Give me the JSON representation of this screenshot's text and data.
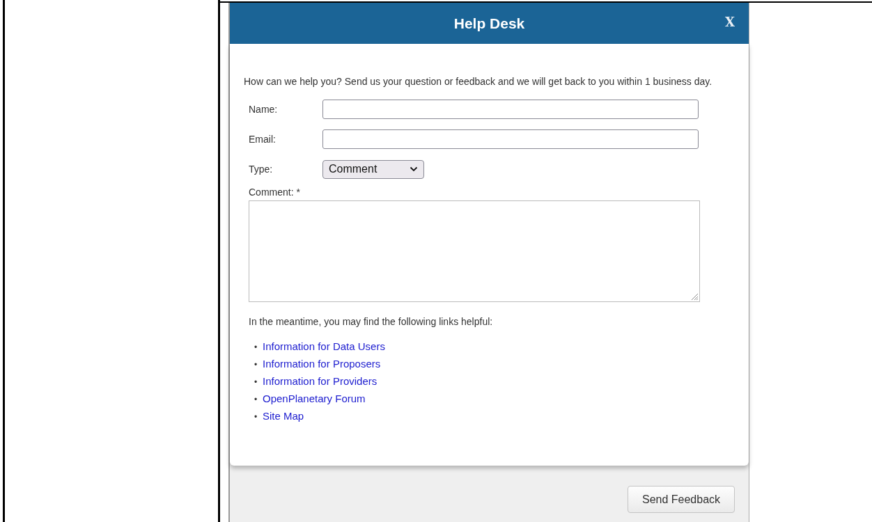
{
  "dialog": {
    "title": "Help Desk",
    "close": "X",
    "intro": "How can we help you? Send us your question or feedback and we will get back to you within 1 business day.",
    "fields": [
      {
        "kind": "text",
        "label": "Name:"
      },
      {
        "kind": "text",
        "label": "Email:"
      },
      {
        "kind": "select",
        "label": "Type:",
        "value": "Comment"
      }
    ],
    "comment_label": "Comment: *",
    "links_intro": "In the meantime, you may find the following links helpful:",
    "bullet": "•",
    "links": [
      "Information for Data Users",
      "Information for Proposers",
      "Information for Providers",
      "OpenPlanetary Forum",
      "Site Map"
    ],
    "submit": "Send Feedback"
  }
}
